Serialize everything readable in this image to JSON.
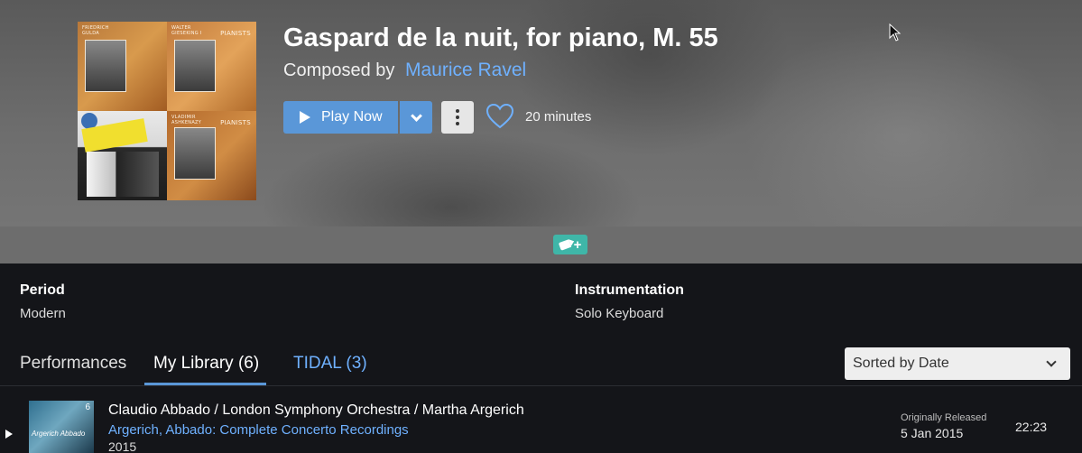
{
  "work": {
    "title": "Gaspard de la nuit, for piano, M. 55",
    "composed_by_label": "Composed by",
    "composer": "Maurice Ravel",
    "duration": "20 minutes"
  },
  "album_art": {
    "tile1": {
      "text": "FRIEDRICH GULDA"
    },
    "tile2": {
      "text": "WALTER GIESEKING I",
      "series": "PIANISTS"
    },
    "tile4": {
      "text": "VLADIMIR ASHKENAZY",
      "series": "PIANISTS"
    }
  },
  "actions": {
    "play_label": "Play Now"
  },
  "tag_button": {
    "plus": "+"
  },
  "metadata": [
    {
      "label": "Period",
      "value": "Modern"
    },
    {
      "label": "Instrumentation",
      "value": "Solo Keyboard"
    }
  ],
  "tabs": [
    {
      "label": "Performances"
    },
    {
      "label": "My Library (6)",
      "active": true
    },
    {
      "label": "TIDAL (3)"
    }
  ],
  "sort": {
    "selected": "Sorted by Date"
  },
  "performances": [
    {
      "performers": "Claudio Abbado / London Symphony Orchestra / Martha Argerich",
      "album": "Argerich, Abbado: Complete Concerto Recordings",
      "year": "2015",
      "art_badge": "6",
      "art_text": "Argerich Abbado",
      "released_label": "Originally Released",
      "released_date": "5 Jan 2015",
      "duration": "22:23"
    }
  ],
  "colors": {
    "accent": "#5a97d8",
    "link": "#6fb1ff",
    "tag": "#3fb6a8",
    "background": "#141519"
  }
}
